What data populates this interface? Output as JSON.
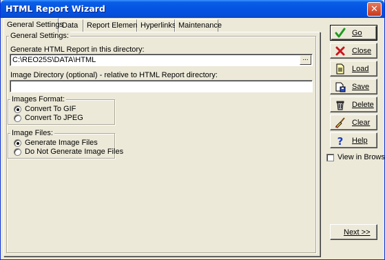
{
  "window": {
    "title": "HTML Report Wizard",
    "close_glyph": "✕"
  },
  "tabs": [
    {
      "label": "General Settings",
      "active": true
    },
    {
      "label": "Data"
    },
    {
      "label": "Report Elements"
    },
    {
      "label": "Hyperlinks"
    },
    {
      "label": "Maintenance"
    }
  ],
  "general": {
    "group_title": "General Settings:",
    "report_dir_label": "Generate HTML Report in this directory:",
    "report_dir_value": "C:\\REO25S\\DATA\\HTML",
    "browse_label": "...",
    "image_dir_label": "Image Directory (optional) - relative to HTML Report directory:",
    "image_dir_value": "",
    "images_format": {
      "title": "Images Format:",
      "options": [
        "Convert To GIF",
        "Convert To JPEG"
      ],
      "selected": "Convert To GIF"
    },
    "image_files": {
      "title": "Image Files:",
      "options": [
        "Generate Image Files",
        "Do Not Generate Image Files"
      ],
      "selected": "Generate Image Files"
    }
  },
  "buttons": {
    "go": "Go",
    "close": "Close",
    "load": "Load",
    "save": "Save",
    "delete": "Delete",
    "clear": "Clear",
    "help": "Help",
    "next": "Next >>"
  },
  "view_in_browser": {
    "label": "View in Browser",
    "checked": false
  },
  "icons": {
    "go": "check-icon",
    "close": "red-x-icon",
    "load": "open-document-icon",
    "save": "save-document-icon",
    "delete": "trash-can-icon",
    "clear": "broom-icon",
    "help": "question-mark-icon"
  },
  "colors": {
    "titlebar": "#0554e3",
    "face": "#ece9d8",
    "check_green": "#1f9a1f",
    "x_red": "#c8161d",
    "help_blue": "#1e3fbf"
  }
}
